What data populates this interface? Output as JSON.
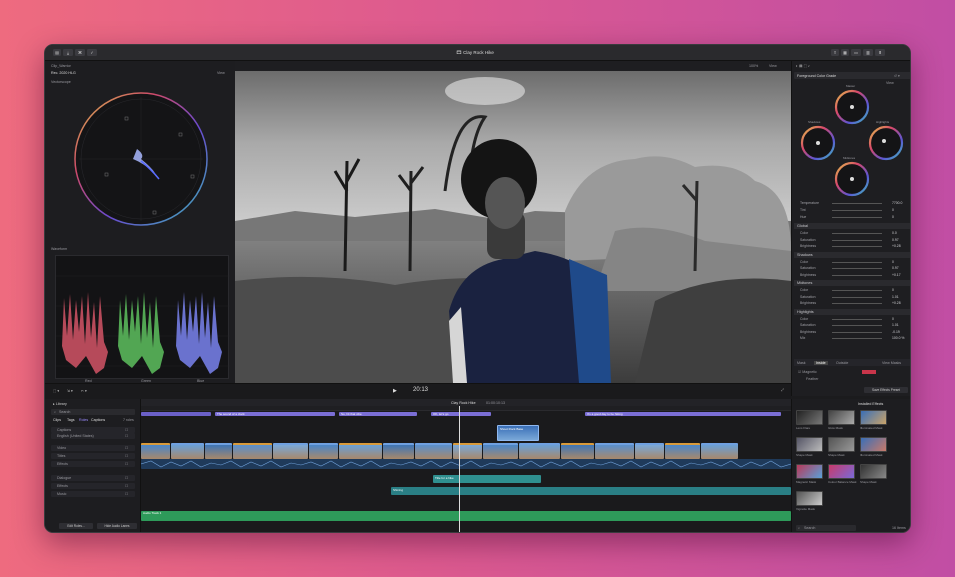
{
  "toolbar": {
    "title": "Clay Rock Hike",
    "viewer_zoom": "100%",
    "view_label": "View",
    "right_label": "Stills to Adobe Rec"
  },
  "scopes": {
    "clip_name": "Clip_Warrior",
    "format": "Rec. 2020 HLG",
    "view_label": "View",
    "vectorscope_label": "Vectorscope",
    "waveform_label": "Waveform",
    "channels": [
      "Red",
      "Green",
      "Blue"
    ]
  },
  "viewer": {
    "timecode": "20:13"
  },
  "inspector": {
    "effect_name": "Foreground Color Grade",
    "view_label": "View",
    "wheels": [
      "Master",
      "Shadows",
      "Highlights",
      "Midtones"
    ],
    "top_rows": [
      {
        "label": "Temperature",
        "value": "7700.0"
      },
      {
        "label": "Tint",
        "value": "0"
      },
      {
        "label": "Hue",
        "value": "0"
      }
    ],
    "sections": [
      {
        "name": "Global",
        "rows": [
          {
            "label": "Color",
            "value": "0.0"
          },
          {
            "label": "Saturation",
            "value": "0.97"
          },
          {
            "label": "Brightness",
            "value": "+0.28"
          }
        ]
      },
      {
        "name": "Shadows",
        "rows": [
          {
            "label": "Color",
            "value": "0"
          },
          {
            "label": "Saturation",
            "value": "0.97"
          },
          {
            "label": "Brightness",
            "value": "+0.17"
          }
        ]
      },
      {
        "name": "Midtones",
        "rows": [
          {
            "label": "Color",
            "value": "0"
          },
          {
            "label": "Saturation",
            "value": "1.01"
          },
          {
            "label": "Brightness",
            "value": "+0.28"
          }
        ]
      },
      {
        "name": "Highlights",
        "rows": [
          {
            "label": "Color",
            "value": "0"
          },
          {
            "label": "Saturation",
            "value": "1.01"
          },
          {
            "label": "Brightness",
            "value": "-0.19"
          },
          {
            "label": "Mix",
            "value": "100.0 %"
          }
        ]
      }
    ],
    "tabs": [
      "Mask",
      "Inside",
      "Outside"
    ],
    "view_masks": "View Masks",
    "mask_item": "Magnetic",
    "feather_label": "Feather",
    "save_button": "Save Effects Preset"
  },
  "browser": {
    "library": "Library",
    "search_placeholder": "Search",
    "tabs": [
      "Clips",
      "Tags",
      "Roles",
      "Captions"
    ],
    "role_count": "7 roles",
    "roles": [
      "Captions",
      "English (United States)",
      "Video",
      "Titles",
      "Effects",
      "Dialogue",
      "Effects",
      "Music"
    ],
    "edit_roles": "Edit Roles...",
    "hide_audio": "Hide Audio Lanes"
  },
  "timeline": {
    "title": "Clay Rock Hike",
    "duration": "01:00:10:13",
    "captions": [
      "The sound of a clock",
      "So, hit that vibe",
      "OK, let's go",
      "It's a good day to be hiking"
    ],
    "connected_clip": "Shoot Rock Base",
    "title_clip": "Title for a hike",
    "music_clip": "Shining",
    "audio_label": "Audio Track 1"
  },
  "effects": {
    "header": "Installed Effects",
    "items": [
      "Lens Flare",
      "Glow Mask",
      "Illuminated Mask",
      "Shape Mask",
      "Shape Mask",
      "Illuminated Mask",
      "Magnetic Mask",
      "Colour Balance Mask",
      "Shape Mask",
      "Vignette Mask"
    ],
    "count": "16 Items",
    "search_placeholder": "Search"
  },
  "colors": {
    "accent": "#6a5acd",
    "caption_clip": "#7b6fd6",
    "video_clip": "#3a6fb7",
    "audio_clip": "#2f8f8f",
    "music_clip": "#2e9a5a"
  }
}
